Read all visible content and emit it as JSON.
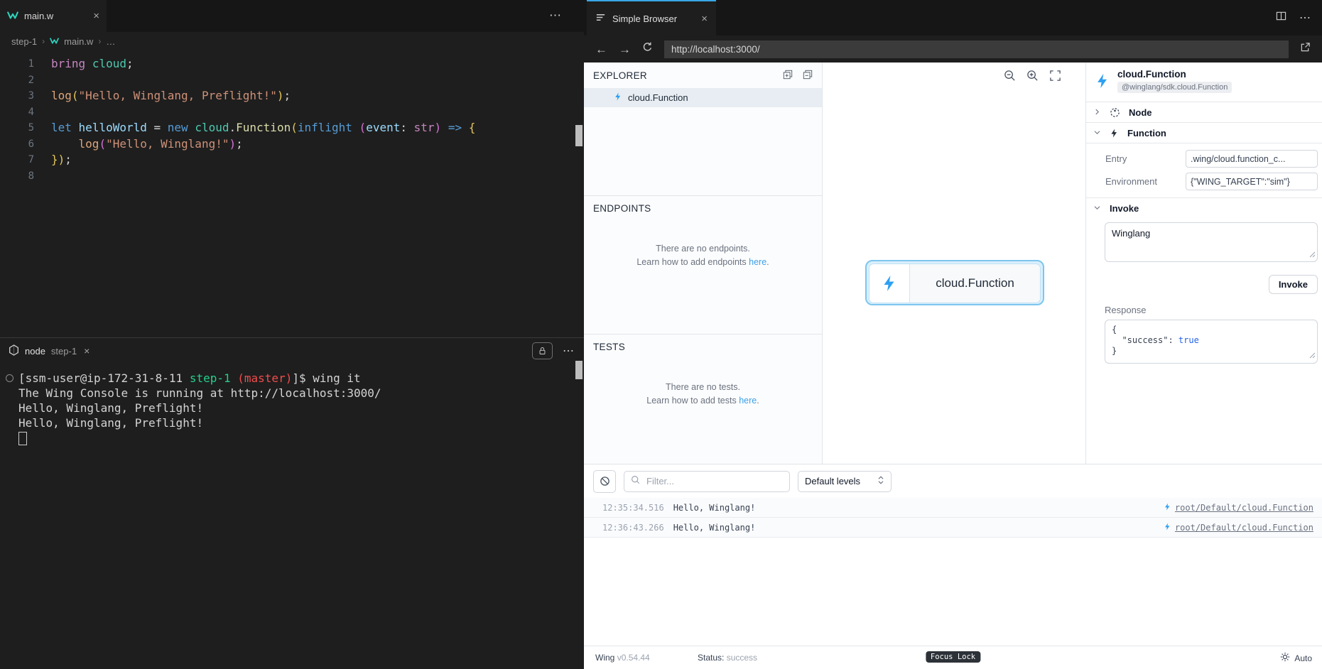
{
  "editor": {
    "tab": {
      "label": "main.w",
      "close": "×"
    },
    "actions_more": "⋯",
    "breadcrumb": {
      "root": "step-1",
      "file": "main.w",
      "tail": "…",
      "sep": "›"
    },
    "line_numbers": [
      "1",
      "2",
      "3",
      "4",
      "5",
      "6",
      "7",
      "8"
    ],
    "code": {
      "l1": [
        {
          "t": "bring",
          "c": "kw2"
        },
        {
          "t": " ",
          "c": "pl"
        },
        {
          "t": "cloud",
          "c": "type"
        },
        {
          "t": ";",
          "c": "pl"
        }
      ],
      "l3": [
        {
          "t": "log",
          "c": "log"
        },
        {
          "t": "(",
          "c": "b1"
        },
        {
          "t": "\"Hello, Winglang, Preflight!\"",
          "c": "str"
        },
        {
          "t": ")",
          "c": "b1"
        },
        {
          "t": ";",
          "c": "pl"
        }
      ],
      "l5": [
        {
          "t": "let",
          "c": "kw"
        },
        {
          "t": " ",
          "c": "pl"
        },
        {
          "t": "helloWorld",
          "c": "var"
        },
        {
          "t": " = ",
          "c": "pl"
        },
        {
          "t": "new",
          "c": "kw"
        },
        {
          "t": " ",
          "c": "pl"
        },
        {
          "t": "cloud",
          "c": "type"
        },
        {
          "t": ".",
          "c": "pl"
        },
        {
          "t": "Function",
          "c": "fn"
        },
        {
          "t": "(",
          "c": "b1"
        },
        {
          "t": "inflight",
          "c": "kw"
        },
        {
          "t": " ",
          "c": "pl"
        },
        {
          "t": "(",
          "c": "b2"
        },
        {
          "t": "event",
          "c": "var"
        },
        {
          "t": ": ",
          "c": "pl"
        },
        {
          "t": "str",
          "c": "kw2"
        },
        {
          "t": ")",
          "c": "b2"
        },
        {
          "t": " ",
          "c": "pl"
        },
        {
          "t": "=>",
          "c": "kw"
        },
        {
          "t": " ",
          "c": "pl"
        },
        {
          "t": "{",
          "c": "b1"
        }
      ],
      "l6": [
        {
          "t": "    ",
          "c": "pl"
        },
        {
          "t": "log",
          "c": "log"
        },
        {
          "t": "(",
          "c": "b2"
        },
        {
          "t": "\"Hello, Winglang!\"",
          "c": "str"
        },
        {
          "t": ")",
          "c": "b2"
        },
        {
          "t": ";",
          "c": "pl"
        }
      ],
      "l7": [
        {
          "t": "}",
          "c": "b1"
        },
        {
          "t": ")",
          "c": "b1"
        },
        {
          "t": ";",
          "c": "pl"
        }
      ]
    }
  },
  "terminal": {
    "tab": {
      "name": "node",
      "detail": "step-1",
      "close": "×"
    },
    "more": "⋯",
    "lines": [
      [
        {
          "t": "[ssm-user@ip-172-31-8-11 ",
          "c": "pl"
        },
        {
          "t": "step-1",
          "c": "green"
        },
        {
          "t": " ",
          "c": "pl"
        },
        {
          "t": "(master)",
          "c": "red"
        },
        {
          "t": "]$ wing it",
          "c": "pl"
        }
      ],
      [
        {
          "t": "The Wing Console is running at http://localhost:3000/",
          "c": "pl"
        }
      ],
      [
        {
          "t": "Hello, Winglang, Preflight!",
          "c": "pl"
        }
      ],
      [
        {
          "t": "Hello, Winglang, Preflight!",
          "c": "pl"
        }
      ]
    ]
  },
  "browser": {
    "tab": {
      "label": "Simple Browser",
      "close": "×"
    },
    "nav": {
      "url": "http://localhost:3000/"
    },
    "console": {
      "explorer": {
        "title": "EXPLORER",
        "item": "cloud.Function"
      },
      "endpoints": {
        "title": "ENDPOINTS",
        "empty_line": "There are no endpoints.",
        "help_prefix": "Learn how to add endpoints ",
        "help_link": "here",
        "help_suffix": "."
      },
      "tests": {
        "title": "TESTS",
        "empty_line": "There are no tests.",
        "help_prefix": "Learn how to add tests ",
        "help_link": "here",
        "help_suffix": "."
      },
      "canvas": {
        "node_label": "cloud.Function"
      },
      "inspector": {
        "title": "cloud.Function",
        "badge": "@winglang/sdk.cloud.Function",
        "node_section": "Node",
        "function_section": "Function",
        "entry_label": "Entry",
        "entry_value": ".wing/cloud.function_c...",
        "env_label": "Environment",
        "env_value": "{\"WING_TARGET\":\"sim\"}",
        "invoke_section": "Invoke",
        "payload": "Winglang",
        "invoke_button": "Invoke",
        "response_label": "Response",
        "response": {
          "open": "{",
          "body": "  \"success\": ",
          "value": "true",
          "close": "}"
        }
      },
      "logbar": {
        "filter_placeholder": "Filter...",
        "levels": "Default levels"
      },
      "logs": [
        {
          "time": "12:35:34.516",
          "message": "Hello, Winglang!",
          "target": "root/Default/cloud.Function"
        },
        {
          "time": "12:36:43.266",
          "message": "Hello, Winglang!",
          "target": "root/Default/cloud.Function"
        }
      ],
      "statusbar": {
        "app": "Wing ",
        "version": "v0.54.44",
        "status_label": "Status: ",
        "status_value": "success",
        "focus_badge": "Focus Lock",
        "theme_label": "Auto"
      }
    }
  },
  "colors": {
    "accent_blue": "#2da0f2",
    "tab_indicator": "#38a7e8",
    "link": "#3ca0e8",
    "terminal_green": "#23d18b",
    "terminal_red": "#f14c4c"
  }
}
